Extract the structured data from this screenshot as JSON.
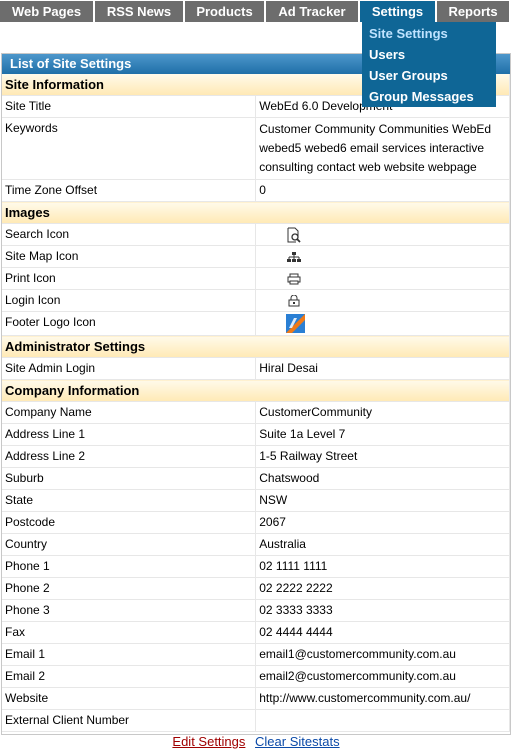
{
  "nav": {
    "items": [
      {
        "label": "Web Pages"
      },
      {
        "label": "RSS News"
      },
      {
        "label": "Products"
      },
      {
        "label": "Ad Tracker"
      },
      {
        "label": "Settings"
      },
      {
        "label": "Reports"
      }
    ],
    "active": "Settings",
    "active_color": "#0f6696",
    "inactive_color": "#6d6d6d"
  },
  "dropdown": {
    "items": [
      {
        "label": "Site Settings"
      },
      {
        "label": "Users"
      },
      {
        "label": "User Groups"
      },
      {
        "label": "Group Messages"
      }
    ]
  },
  "panel": {
    "title": "List of Site Settings",
    "sections": {
      "site_information": "Site Information",
      "images": "Images",
      "administrator_settings": "Administrator Settings",
      "company_information": "Company Information"
    },
    "site": {
      "title_label": "Site Title",
      "title_value": "WebEd 6.0 Development",
      "keywords_label": "Keywords",
      "keywords_value": "Customer Community Communities WebEd webed5 webed6 email services interactive consulting contact web website webpage",
      "timezone_label": "Time Zone Offset",
      "timezone_value": "0"
    },
    "images": {
      "search_label": "Search Icon",
      "search_icon": "search-page-icon",
      "sitemap_label": "Site Map Icon",
      "sitemap_icon": "sitemap-icon",
      "print_label": "Print Icon",
      "print_icon": "printer-icon",
      "login_label": "Login Icon",
      "login_icon": "lock-icon",
      "footer_label": "Footer Logo Icon",
      "footer_icon": "footer-logo-icon"
    },
    "admin": {
      "login_label": "Site Admin Login",
      "login_value": "Hiral Desai"
    },
    "company": {
      "name_label": "Company Name",
      "name_value": "CustomerCommunity",
      "addr1_label": "Address Line 1",
      "addr1_value": "Suite 1a Level 7",
      "addr2_label": "Address Line 2",
      "addr2_value": "1-5 Railway Street",
      "suburb_label": "Suburb",
      "suburb_value": "Chatswood",
      "state_label": "State",
      "state_value": "NSW",
      "postcode_label": "Postcode",
      "postcode_value": "2067",
      "country_label": "Country",
      "country_value": "Australia",
      "phone1_label": "Phone 1",
      "phone1_value": "02 1111 1111",
      "phone2_label": "Phone 2",
      "phone2_value": "02 2222 2222",
      "phone3_label": "Phone 3",
      "phone3_value": "02 3333 3333",
      "fax_label": "Fax",
      "fax_value": "02 4444 4444",
      "email1_label": "Email 1",
      "email1_value": "email1@customercommunity.com.au",
      "email2_label": "Email 2",
      "email2_value": "email2@customercommunity.com.au",
      "website_label": "Website",
      "website_value": "http://www.customercommunity.com.au/",
      "ext_label": "External Client Number",
      "ext_value": ""
    },
    "footer": {
      "edit_label": "Edit Settings",
      "clear_label": "Clear Sitestats"
    }
  }
}
